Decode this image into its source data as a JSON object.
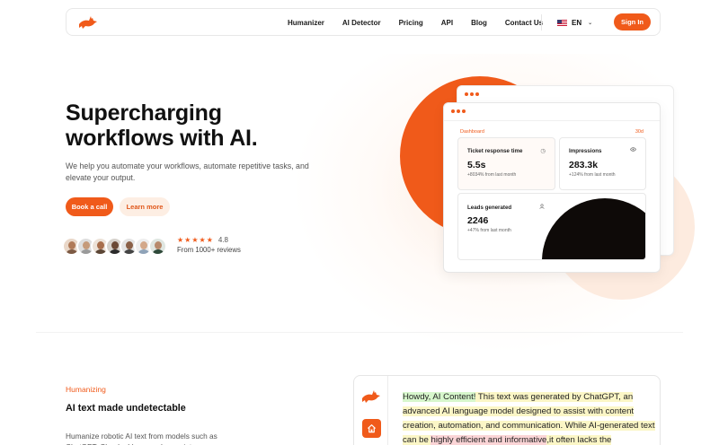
{
  "nav": {
    "links": [
      "Humanizer",
      "AI Detector",
      "Pricing",
      "API",
      "Blog",
      "Contact Us"
    ],
    "language": "EN",
    "sign_in": "Sign In"
  },
  "hero": {
    "title_line1": "Supercharging",
    "title_line2": "workflows with AI.",
    "subtitle": "We help you automate your workflows, automate repetitive tasks, and elevate your output.",
    "primary_cta": "Book a call",
    "secondary_cta": "Learn more",
    "rating": "4.8",
    "stars": 5,
    "reviews": "From 1000+ reviews"
  },
  "dashboard": {
    "label": "Dashboard",
    "range": "30d",
    "cards": [
      {
        "title": "Ticket response time",
        "value": "5.5s",
        "delta": "+8034% from last month",
        "icon": "clock-icon"
      },
      {
        "title": "Impressions",
        "value": "283.3k",
        "delta": "+124% from last month",
        "icon": "eye-icon"
      },
      {
        "title": "Leads generated",
        "value": "2246",
        "delta": "+47% from last month",
        "icon": "user-icon"
      }
    ]
  },
  "section": {
    "eyebrow": "Humanizing",
    "title": "AI text made undetectable",
    "text": "Humanize robotic AI text from models such as ChatGPT, Claude, Llama and more into"
  },
  "demo": {
    "seg1": "Howdy, AI Content!",
    "seg2": " This text was generated by ChatGPT, an advanced AI language model designed to assist with content creation, automation, and communication. While AI-generated text can be ",
    "seg3": "highly efficient and informative",
    "seg4": ",it often lacks the"
  },
  "colors": {
    "accent": "#f05a1a",
    "accent_soft": "#fdeee3",
    "dark_shape": "#0e0a08"
  }
}
